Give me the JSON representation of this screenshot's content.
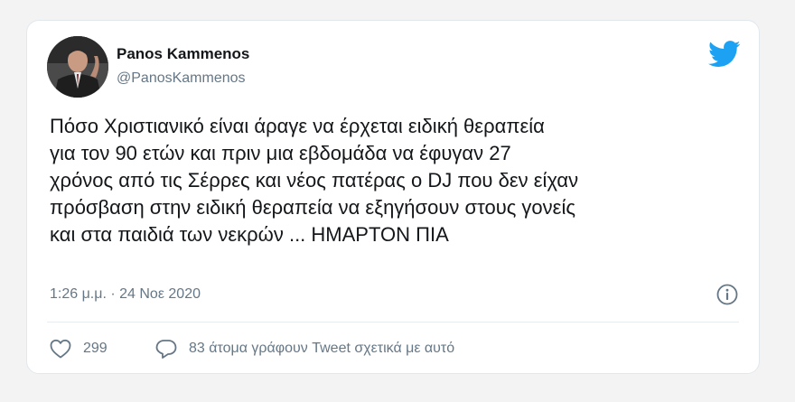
{
  "author": {
    "name": "Panos Kammenos",
    "handle": "@PanosKammenos"
  },
  "tweet": {
    "lines": [
      "Πόσο Χριστιανικό είναι άραγε να έρχεται ειδική θεραπεία",
      "για τον 90 ετών και πριν μια εβδομάδα να έφυγαν 27",
      "χρόνος από τις Σέρρες και νέος πατέρας ο DJ που δεν είχαν",
      "πρόσβαση στην ειδική θεραπεία να εξηγήσουν στους γονείς",
      "και στα παιδιά των νεκρών ... ΗΜΑΡΤΟΝ ΠΙΑ"
    ],
    "timestamp": "1:26 μ.μ. · 24 Νοε 2020"
  },
  "actions": {
    "likes": "299",
    "replies_text": "83 άτομα γράφουν Tweet σχετικά με αυτό"
  },
  "icons": {
    "brand": "twitter-bird-icon",
    "info": "info-icon",
    "like": "heart-icon",
    "reply": "speech-bubble-icon"
  },
  "colors": {
    "brand": "#1da1f2",
    "text": "#14171a",
    "secondary": "#657786"
  }
}
